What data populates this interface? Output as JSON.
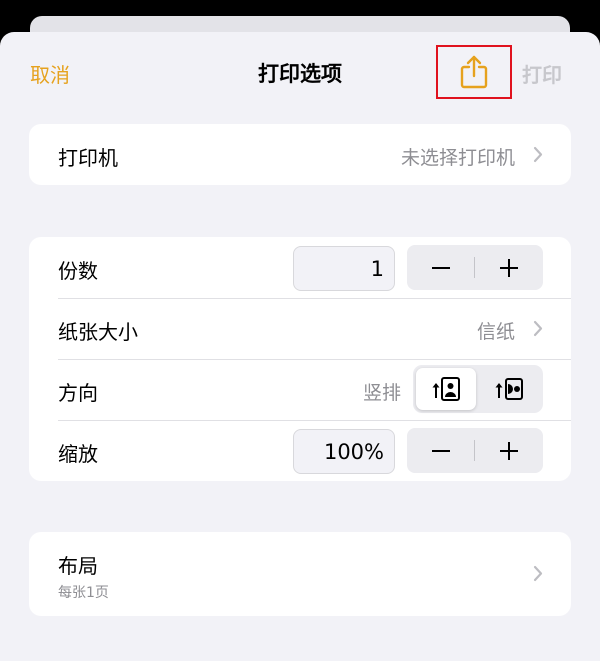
{
  "header": {
    "cancel_label": "取消",
    "title": "打印选项",
    "share_icon": "share-icon",
    "print_label": "打印"
  },
  "printer": {
    "label": "打印机",
    "value": "未选择打印机"
  },
  "options": {
    "copies": {
      "label": "份数",
      "value": "1"
    },
    "paper_size": {
      "label": "纸张大小",
      "value": "信纸"
    },
    "orientation": {
      "label": "方向",
      "value": "竖排",
      "options": [
        "portrait",
        "landscape"
      ],
      "selected": "portrait"
    },
    "scale": {
      "label": "缩放",
      "value": "100%"
    }
  },
  "layout": {
    "label": "布局",
    "subtitle": "每张1页"
  },
  "colors": {
    "accent": "#e6a21e",
    "highlight_box": "#e0121e",
    "disabled": "#c7c7cc",
    "secondary_text": "#8e8e93"
  }
}
